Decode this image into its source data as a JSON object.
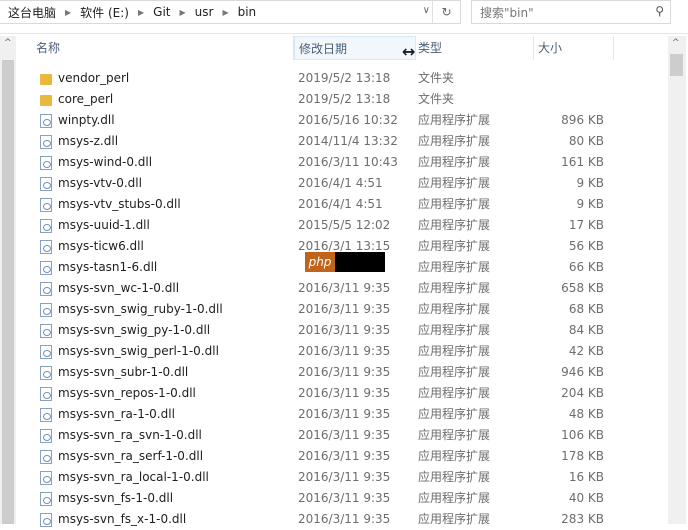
{
  "address": {
    "crumbs": [
      "这台电脑",
      "软件 (E:)",
      "Git",
      "usr",
      "bin"
    ]
  },
  "search": {
    "placeholder": "搜索\"bin\""
  },
  "columns": [
    "名称",
    "修改日期",
    "类型",
    "大小"
  ],
  "files": [
    {
      "name": "vendor_perl",
      "date": "2019/5/2 13:18",
      "type": "文件夹",
      "size": "",
      "kind": "folder"
    },
    {
      "name": "core_perl",
      "date": "2019/5/2 13:18",
      "type": "文件夹",
      "size": "",
      "kind": "folder"
    },
    {
      "name": "winpty.dll",
      "date": "2016/5/16 10:32",
      "type": "应用程序扩展",
      "size": "896 KB",
      "kind": "file"
    },
    {
      "name": "msys-z.dll",
      "date": "2014/11/4 13:32",
      "type": "应用程序扩展",
      "size": "80 KB",
      "kind": "file"
    },
    {
      "name": "msys-wind-0.dll",
      "date": "2016/3/11 10:43",
      "type": "应用程序扩展",
      "size": "161 KB",
      "kind": "file"
    },
    {
      "name": "msys-vtv-0.dll",
      "date": "2016/4/1 4:51",
      "type": "应用程序扩展",
      "size": "9 KB",
      "kind": "file"
    },
    {
      "name": "msys-vtv_stubs-0.dll",
      "date": "2016/4/1 4:51",
      "type": "应用程序扩展",
      "size": "9 KB",
      "kind": "file"
    },
    {
      "name": "msys-uuid-1.dll",
      "date": "2015/5/5 12:02",
      "type": "应用程序扩展",
      "size": "17 KB",
      "kind": "file"
    },
    {
      "name": "msys-ticw6.dll",
      "date": "2016/3/1 13:15",
      "type": "应用程序扩展",
      "size": "56 KB",
      "kind": "file"
    },
    {
      "name": "msys-tasn1-6.dll",
      "date": "",
      "type": "应用程序扩展",
      "size": "66 KB",
      "kind": "file"
    },
    {
      "name": "msys-svn_wc-1-0.dll",
      "date": "2016/3/11 9:35",
      "type": "应用程序扩展",
      "size": "658 KB",
      "kind": "file"
    },
    {
      "name": "msys-svn_swig_ruby-1-0.dll",
      "date": "2016/3/11 9:35",
      "type": "应用程序扩展",
      "size": "68 KB",
      "kind": "file"
    },
    {
      "name": "msys-svn_swig_py-1-0.dll",
      "date": "2016/3/11 9:35",
      "type": "应用程序扩展",
      "size": "84 KB",
      "kind": "file"
    },
    {
      "name": "msys-svn_swig_perl-1-0.dll",
      "date": "2016/3/11 9:35",
      "type": "应用程序扩展",
      "size": "42 KB",
      "kind": "file"
    },
    {
      "name": "msys-svn_subr-1-0.dll",
      "date": "2016/3/11 9:35",
      "type": "应用程序扩展",
      "size": "946 KB",
      "kind": "file"
    },
    {
      "name": "msys-svn_repos-1-0.dll",
      "date": "2016/3/11 9:35",
      "type": "应用程序扩展",
      "size": "204 KB",
      "kind": "file"
    },
    {
      "name": "msys-svn_ra-1-0.dll",
      "date": "2016/3/11 9:35",
      "type": "应用程序扩展",
      "size": "48 KB",
      "kind": "file"
    },
    {
      "name": "msys-svn_ra_svn-1-0.dll",
      "date": "2016/3/11 9:35",
      "type": "应用程序扩展",
      "size": "106 KB",
      "kind": "file"
    },
    {
      "name": "msys-svn_ra_serf-1-0.dll",
      "date": "2016/3/11 9:35",
      "type": "应用程序扩展",
      "size": "178 KB",
      "kind": "file"
    },
    {
      "name": "msys-svn_ra_local-1-0.dll",
      "date": "2016/3/11 9:35",
      "type": "应用程序扩展",
      "size": "16 KB",
      "kind": "file"
    },
    {
      "name": "msys-svn_fs-1-0.dll",
      "date": "2016/3/11 9:35",
      "type": "应用程序扩展",
      "size": "40 KB",
      "kind": "file"
    },
    {
      "name": "msys-svn_fs_x-1-0.dll",
      "date": "2016/3/11 9:35",
      "type": "应用程序扩展",
      "size": "283 KB",
      "kind": "file"
    }
  ],
  "watermark": "php"
}
